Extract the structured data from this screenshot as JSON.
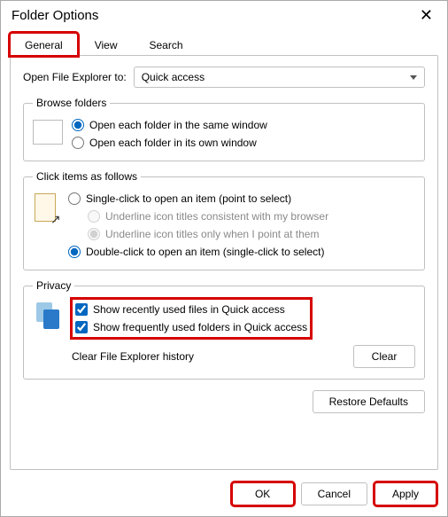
{
  "window": {
    "title": "Folder Options"
  },
  "tabs": {
    "general": "General",
    "view": "View",
    "search": "Search"
  },
  "openExplorer": {
    "label": "Open File Explorer to:",
    "selected": "Quick access"
  },
  "browse": {
    "legend": "Browse folders",
    "same": "Open each folder in the same window",
    "own": "Open each folder in its own window"
  },
  "click": {
    "legend": "Click items as follows",
    "single": "Single-click to open an item (point to select)",
    "underlineBrowser": "Underline icon titles consistent with my browser",
    "underlinePoint": "Underline icon titles only when I point at them",
    "double": "Double-click to open an item (single-click to select)"
  },
  "privacy": {
    "legend": "Privacy",
    "recent": "Show recently used files in Quick access",
    "frequent": "Show frequently used folders in Quick access",
    "clearLabel": "Clear File Explorer history",
    "clearBtn": "Clear"
  },
  "buttons": {
    "restore": "Restore Defaults",
    "ok": "OK",
    "cancel": "Cancel",
    "apply": "Apply"
  }
}
